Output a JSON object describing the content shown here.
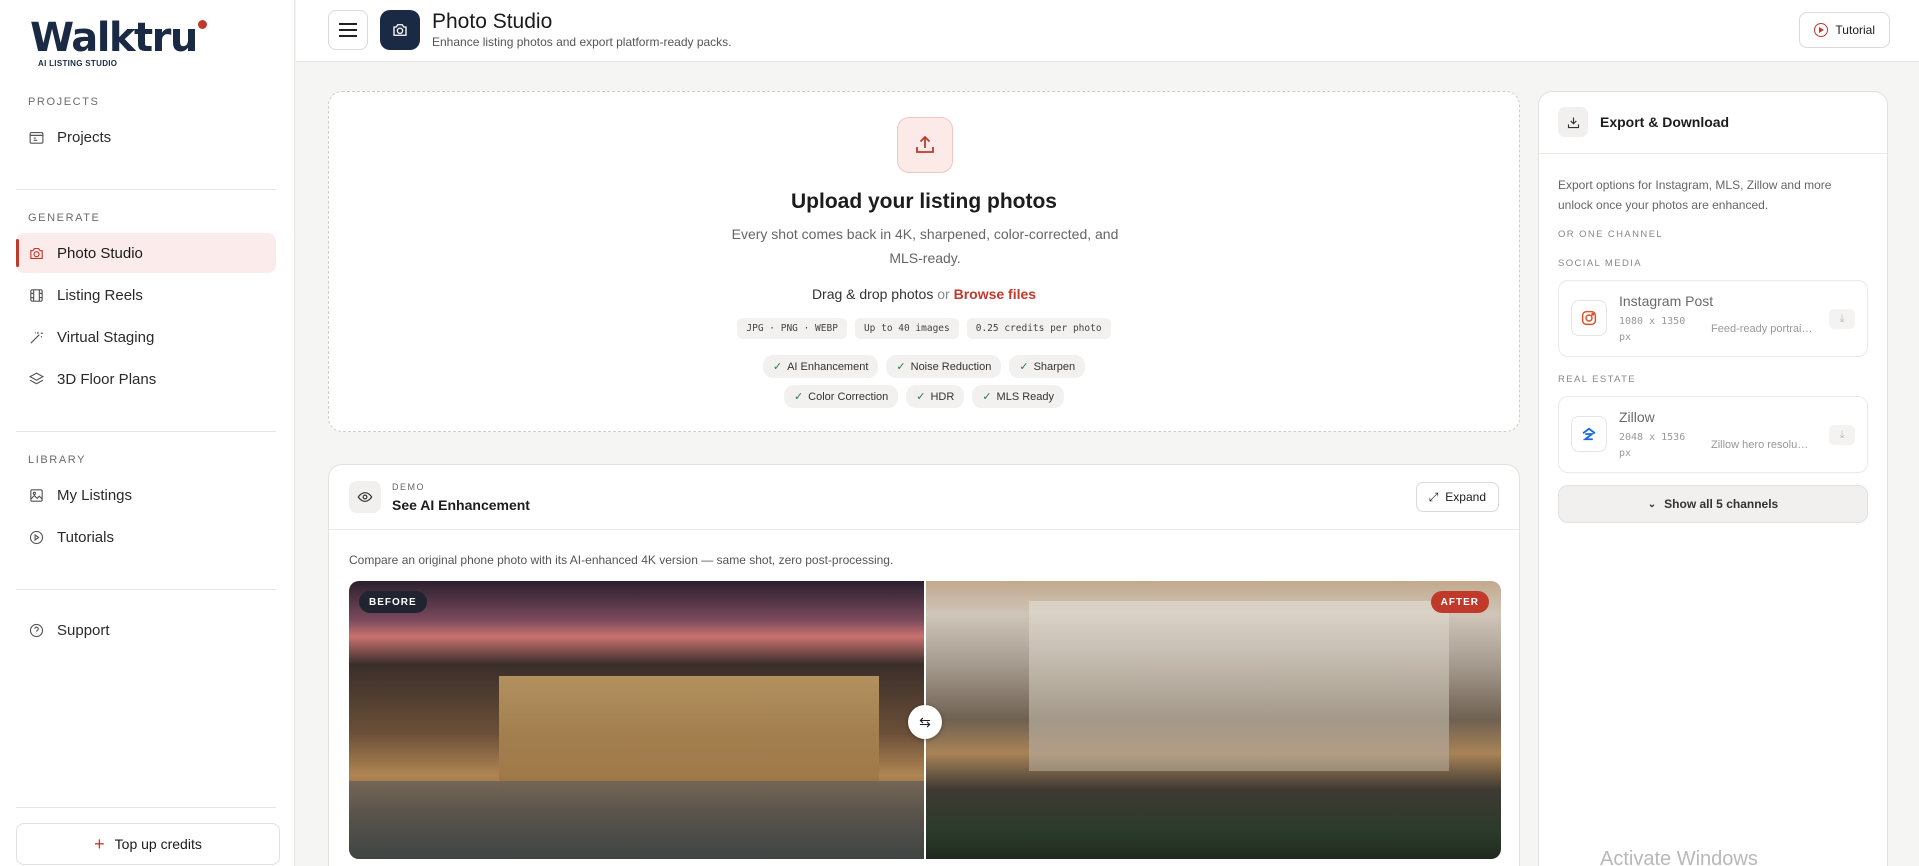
{
  "brand": {
    "name": "Walktru",
    "tagline": "AI LISTING STUDIO",
    "accent": "#c0392b",
    "navy": "#1a2a44"
  },
  "sidebar": {
    "sections": [
      {
        "label": "PROJECTS",
        "items": [
          {
            "label": "Projects",
            "icon": "folder-icon"
          }
        ]
      },
      {
        "label": "GENERATE",
        "items": [
          {
            "label": "Photo Studio",
            "icon": "camera-icon",
            "active": true
          },
          {
            "label": "Listing Reels",
            "icon": "film-icon"
          },
          {
            "label": "Virtual Staging",
            "icon": "wand-icon"
          },
          {
            "label": "3D Floor Plans",
            "icon": "layers-icon"
          }
        ]
      },
      {
        "label": "LIBRARY",
        "items": [
          {
            "label": "My Listings",
            "icon": "images-icon"
          },
          {
            "label": "Tutorials",
            "icon": "play-circle-icon"
          }
        ]
      }
    ],
    "support": "Support",
    "topup": "Top up credits"
  },
  "header": {
    "title": "Photo Studio",
    "subtitle": "Enhance listing photos and export platform-ready packs.",
    "tutorial": "Tutorial"
  },
  "upload": {
    "title": "Upload your listing photos",
    "description": "Every shot comes back in 4K, sharpened, color-corrected, and MLS-ready.",
    "drag": "Drag & drop photos",
    "or": "or",
    "browse": "Browse files",
    "specs": [
      "JPG · PNG · WEBP",
      "Up to 40 images",
      "0.25 credits per photo"
    ],
    "features_row1": [
      "AI Enhancement",
      "Noise Reduction",
      "Sharpen"
    ],
    "features_row2": [
      "Color Correction",
      "HDR",
      "MLS Ready"
    ]
  },
  "demo": {
    "kicker": "DEMO",
    "title": "See AI Enhancement",
    "expand": "Expand",
    "description": "Compare an original phone photo with its AI-enhanced 4K version — same shot, zero post-processing.",
    "before_label": "BEFORE",
    "after_label": "AFTER",
    "split_position": 0.5
  },
  "export": {
    "title": "Export & Download",
    "description": "Export options for Instagram, MLS, Zillow and more unlock once your photos are enhanced.",
    "or_one_channel": "OR ONE CHANNEL",
    "groups": [
      {
        "label": "SOCIAL MEDIA",
        "channel": {
          "name": "Instagram Post",
          "size": "1080 x 1350 px",
          "desc": "Feed-ready portrai…",
          "icon": "instagram-icon"
        }
      },
      {
        "label": "REAL ESTATE",
        "channel": {
          "name": "Zillow",
          "size": "2048 x 1536 px",
          "desc": "Zillow hero resolu…",
          "icon": "zillow-icon"
        }
      }
    ],
    "show_all": "Show all 5 channels"
  },
  "watermark": "Activate Windows"
}
